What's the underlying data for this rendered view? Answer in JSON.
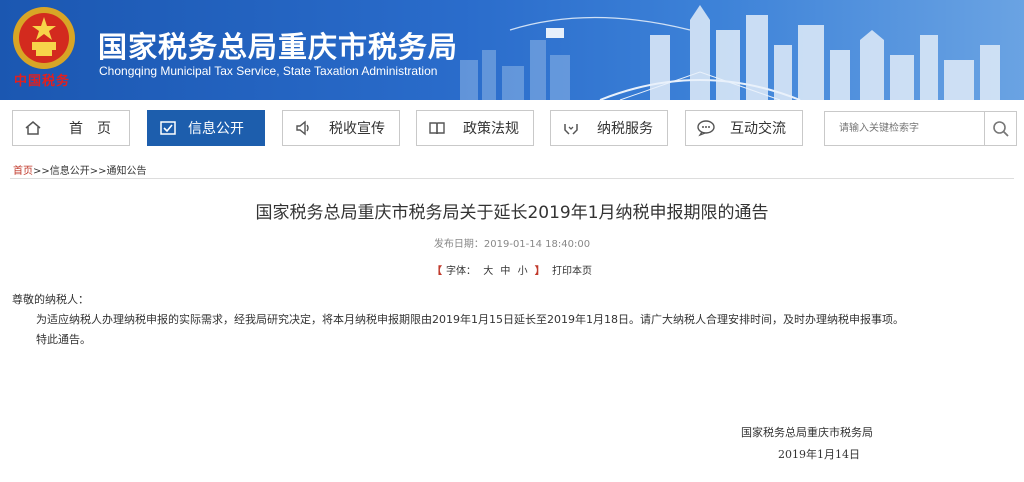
{
  "header": {
    "title": "国家税务总局重庆市税务局",
    "subtitle": "Chongqing Municipal Tax Service, State Taxation Administration",
    "emblem_text": "中国税务",
    "colors": {
      "banner": "#2a6ccb",
      "accent": "#1d5ead",
      "emblem_red": "#e02020"
    }
  },
  "nav": {
    "items": [
      {
        "label": "首　页",
        "icon": "home-icon"
      },
      {
        "label": "信息公开",
        "icon": "checklist-icon",
        "active": true
      },
      {
        "label": "税收宣传",
        "icon": "speaker-icon"
      },
      {
        "label": "政策法规",
        "icon": "book-icon"
      },
      {
        "label": "纳税服务",
        "icon": "hands-icon"
      },
      {
        "label": "互动交流",
        "icon": "chat-icon"
      }
    ],
    "search_placeholder": "请输入关键检索字"
  },
  "breadcrumb": {
    "home": "首页",
    "rest": ">>信息公开>>通知公告"
  },
  "article": {
    "title": "国家税务总局重庆市税务局关于延长2019年1月纳税申报期限的通告",
    "pubdate": "发布日期：2019-01-14 18:40:00",
    "font_label": "字体：",
    "font_large": "大",
    "font_medium": "中",
    "font_small": "小",
    "print": "打印本页",
    "salutation": "尊敬的纳税人：",
    "paragraph1": "为适应纳税人办理纳税申报的实际需求，经我局研究决定，将本月纳税申报期限由2019年1月15日延长至2019年1月18日。请广大纳税人合理安排时间，及时办理纳税申报事项。",
    "paragraph2": "特此通告。",
    "sign_org": "国家税务总局重庆市税务局",
    "sign_date": "2019年1月14日"
  }
}
